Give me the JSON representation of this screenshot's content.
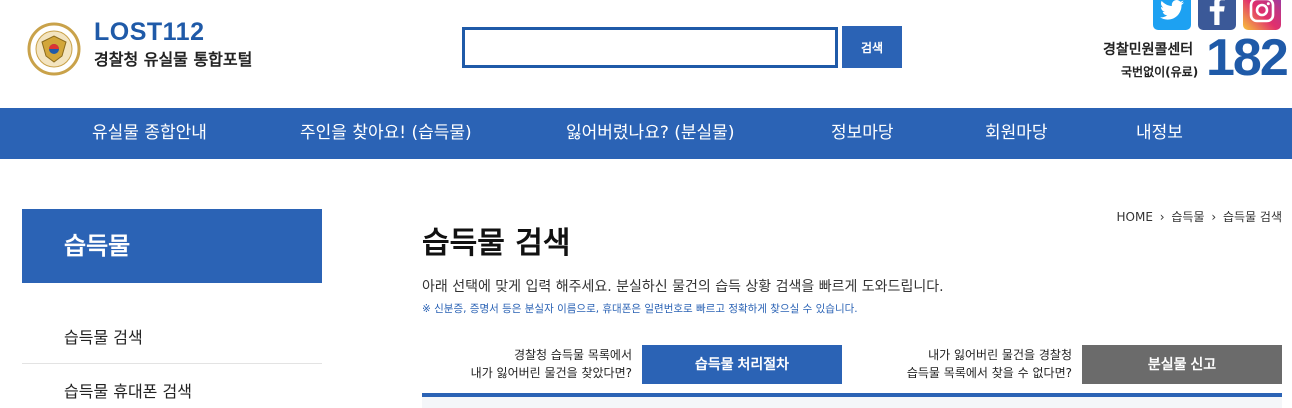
{
  "header": {
    "logo_title": "LOST112",
    "logo_subtitle": "경찰청 유실물 통합포털",
    "emblem_text": "KOREAN NATIONAL POLICE AGENCY",
    "search_placeholder": "",
    "search_button": "검색",
    "callcenter_label": "경찰민원콜센터",
    "callcenter_sub": "국번없이(유료)",
    "callcenter_number": "182",
    "colors": {
      "brand": "#2b63b5",
      "title": "#1f5aa8"
    }
  },
  "nav": {
    "items": [
      "유실물 종합안내",
      "주인을 찾아요! (습득물)",
      "잃어버렸나요? (분실물)",
      "정보마당",
      "회원마당",
      "내정보"
    ]
  },
  "sidebar": {
    "title": "습득물",
    "items": [
      "습득물 검색",
      "습득물 휴대폰 검색"
    ]
  },
  "main": {
    "breadcrumb": [
      "HOME",
      "습득물",
      "습득물 검색"
    ],
    "title": "습득물 검색",
    "description": "아래 선택에 맞게 입력 해주세요. 분실하신 물건의 습득 상황 검색을 빠르게 도와드립니다.",
    "note": "※ 신분증, 증명서 등은 분실자 이름으로, 휴대폰은 일련번호로 빠르고 정확하게 찾으실 수 있습니다.",
    "left_prompt_line1": "경찰청 습득물 목록에서",
    "left_prompt_line2": "내가 잃어버린 물건을 찾았다면?",
    "left_button": "습득물 처리절차",
    "right_prompt_line1": "내가 잃어버린 물건을 경찰청",
    "right_prompt_line2": "습득물 목록에서 찾을 수 없다면?",
    "right_button": "분실물 신고"
  }
}
